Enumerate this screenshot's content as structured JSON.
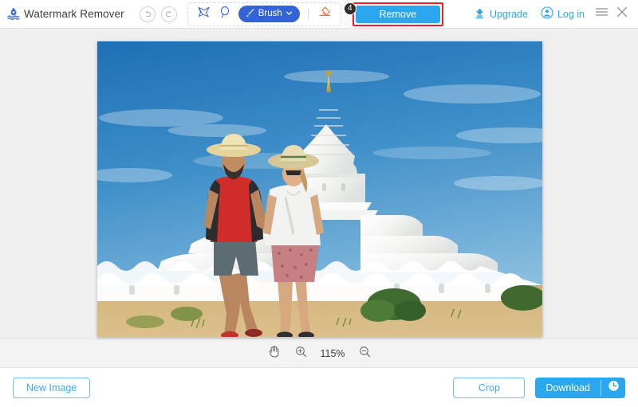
{
  "app": {
    "title": "Watermark Remover",
    "logo_icon": "watermark-drop-waves-logo"
  },
  "toolbar": {
    "undo_icon": "undo-arrow-icon",
    "redo_icon": "redo-arrow-icon",
    "tools": [
      {
        "name": "polygon-lasso-tool",
        "icon": "polygon-lasso-icon"
      },
      {
        "name": "lasso-tool",
        "icon": "lasso-icon"
      }
    ],
    "brush": {
      "label": "Brush",
      "icon": "brush-icon",
      "chevron_icon": "chevron-down-icon",
      "active": true
    },
    "eraser": {
      "name": "eraser-tool",
      "icon": "eraser-icon"
    },
    "remove": {
      "label": "Remove",
      "step_badge": "4",
      "highlighted": true
    }
  },
  "account": {
    "upgrade_label": "Upgrade",
    "upgrade_icon": "upload-upgrade-icon",
    "login_label": "Log in",
    "login_icon": "user-circle-icon",
    "menu_icon": "hamburger-menu-icon",
    "close_icon": "close-icon"
  },
  "canvas": {
    "image_alt": "Two tourists walking in front of a white Hsinbyume pagoda under a blue sky"
  },
  "zoombar": {
    "pan_icon": "hand-pan-icon",
    "zoom_in_icon": "zoom-in-icon",
    "zoom_out_icon": "zoom-out-icon",
    "zoom_level": "115%"
  },
  "footer": {
    "new_image_label": "New Image",
    "crop_label": "Crop",
    "download_label": "Download",
    "download_history_icon": "clock-history-icon"
  },
  "colors": {
    "accent_blue": "#2aa7ef",
    "brush_blue": "#3363d6",
    "highlight_red": "#ee1c25",
    "eraser_orange": "#e8733a",
    "canvas_bg": "#efefef"
  }
}
